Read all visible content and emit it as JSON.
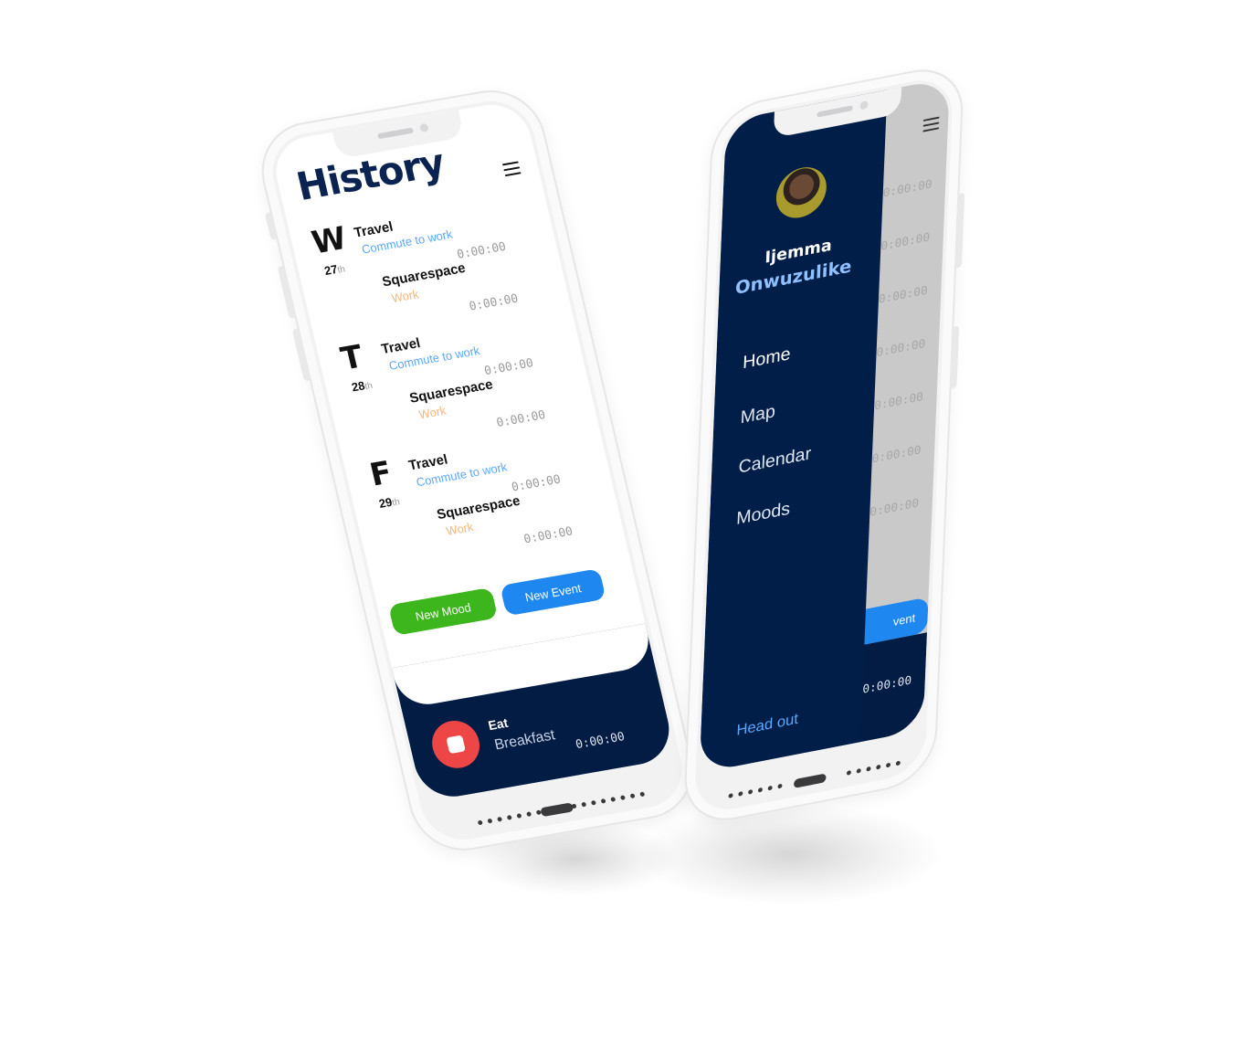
{
  "history_screen": {
    "title": "History",
    "days": [
      {
        "letter": "W",
        "number": "27",
        "suffix": "th",
        "events": [
          {
            "title": "Travel",
            "subtitle": "Commute to work",
            "subtitle_color": "#5aa7ff",
            "time": "0:00:00"
          },
          {
            "title": "Squarespace",
            "subtitle": "Work",
            "subtitle_color": "#f5b77a",
            "time": "0:00:00"
          }
        ]
      },
      {
        "letter": "T",
        "number": "28",
        "suffix": "th",
        "events": [
          {
            "title": "Travel",
            "subtitle": "Commute to work",
            "subtitle_color": "#5aa7ff",
            "time": "0:00:00"
          },
          {
            "title": "Squarespace",
            "subtitle": "Work",
            "subtitle_color": "#f5b77a",
            "time": "0:00:00"
          }
        ]
      },
      {
        "letter": "F",
        "number": "29",
        "suffix": "th",
        "events": [
          {
            "title": "Travel",
            "subtitle": "Commute to work",
            "subtitle_color": "#5aa7ff",
            "time": "0:00:00"
          },
          {
            "title": "Squarespace",
            "subtitle": "Work",
            "subtitle_color": "#f5b77a",
            "time": "0:00:00"
          }
        ]
      }
    ],
    "buttons": {
      "new_mood": "New Mood",
      "new_event": "New Event"
    },
    "current": {
      "title": "Eat",
      "subtitle": "Breakfast",
      "time": "0:00:00"
    }
  },
  "menu_screen": {
    "user": {
      "first_name": "Ijemma",
      "last_name": "Onwuzulike"
    },
    "nav": [
      "Home",
      "Map",
      "Calendar",
      "Moods"
    ],
    "logout": "Head out",
    "background_times": [
      "0:00:00",
      "0:00:00",
      "0:00:00",
      "0:00:00",
      "0:00:00",
      "0:00:00",
      "0:00:00"
    ],
    "background_button": "vent",
    "background_bottom_time": "0:00:00"
  },
  "colors": {
    "navy": "#031c44",
    "drawer": "#001e47",
    "green": "#3db51c",
    "blue": "#1e87f0",
    "record_red": "#ee4646"
  }
}
